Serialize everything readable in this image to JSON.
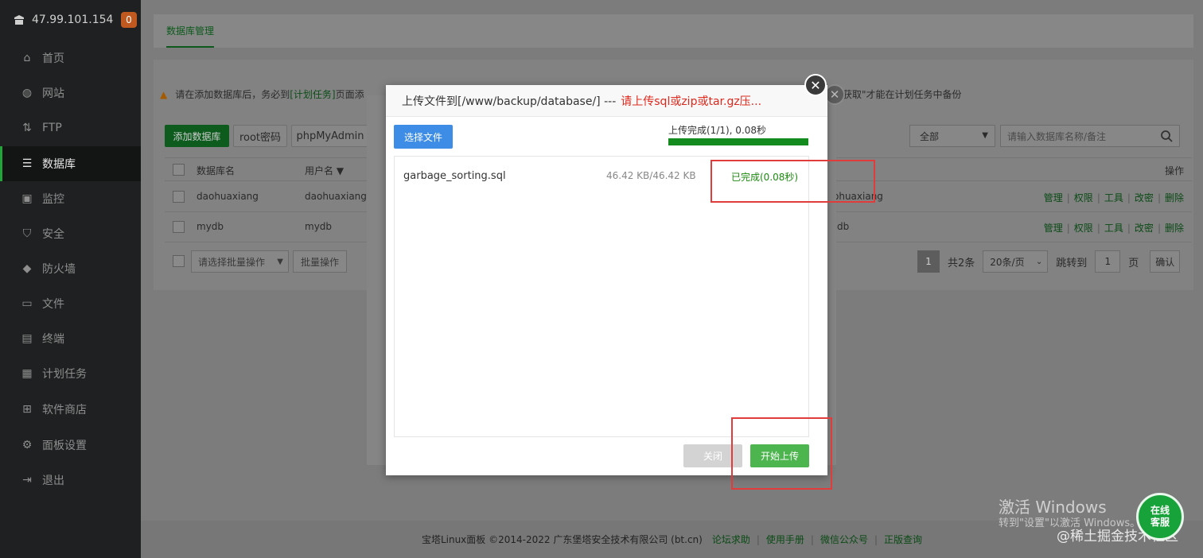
{
  "sidebar": {
    "host": "47.99.101.154",
    "badge": "0",
    "items": [
      {
        "label": "首页",
        "icon": "home-icon"
      },
      {
        "label": "网站",
        "icon": "globe-icon"
      },
      {
        "label": "FTP",
        "icon": "ftp-icon"
      },
      {
        "label": "数据库",
        "icon": "database-icon"
      },
      {
        "label": "监控",
        "icon": "monitor-icon"
      },
      {
        "label": "安全",
        "icon": "shield-icon"
      },
      {
        "label": "防火墙",
        "icon": "firewall-icon"
      },
      {
        "label": "文件",
        "icon": "folder-icon"
      },
      {
        "label": "终端",
        "icon": "terminal-icon"
      },
      {
        "label": "计划任务",
        "icon": "calendar-icon"
      },
      {
        "label": "软件商店",
        "icon": "apps-icon"
      },
      {
        "label": "面板设置",
        "icon": "settings-icon"
      },
      {
        "label": "退出",
        "icon": "logout-icon"
      }
    ],
    "active": "数据库"
  },
  "main": {
    "tab": "数据库管理",
    "warning_pre": "请在添加数据库后，务必到",
    "warning_link": "[计划任务]",
    "warning_post": "页面添",
    "warning_tail": "器获取\"才能在计划任务中备份",
    "toolbar": {
      "add": "添加数据库",
      "root": "root密码",
      "phpmyadmin": "phpMyAdmin",
      "filter": "全部",
      "search_placeholder": "请输入数据库名称/备注"
    },
    "table": {
      "headers": {
        "name": "数据库名",
        "user": "用户名",
        "ops": "操作"
      },
      "rows": [
        {
          "name": "daohuaxiang",
          "user": "daohuaxiang",
          "note": "ohuaxiang"
        },
        {
          "name": "mydb",
          "user": "mydb",
          "note": "db"
        }
      ],
      "ops": [
        "管理",
        "权限",
        "工具",
        "改密",
        "删除"
      ]
    },
    "batch": {
      "select": "请选择批量操作",
      "button": "批量操作"
    },
    "pager": {
      "page": "1",
      "total": "共2条",
      "per_page": "20条/页",
      "goto": "跳转到",
      "goto_value": "1",
      "page_unit": "页",
      "confirm": "确认"
    }
  },
  "footer": {
    "copyright": "宝塔Linux面板 ©2014-2022 广东堡塔安全技术有限公司 (bt.cn)",
    "links": [
      "论坛求助",
      "使用手册",
      "微信公众号",
      "正版查询"
    ]
  },
  "modal": {
    "title": "上传文件到[/www/backup/database/] ---",
    "title_warning": "请上传sql或zip或tar.gz压...",
    "choose_button": "选择文件",
    "progress_label": "上传完成(1/1), 0.08秒",
    "progress": 1.0,
    "file": {
      "name": "garbage_sorting.sql",
      "size": "46.42 KB/46.42 KB",
      "status": "已完成(0.08秒)"
    },
    "close_button": "关闭",
    "start_button": "开始上传"
  },
  "overlay": {
    "watermark_title": "激活 Windows",
    "watermark_sub": "转到\"设置\"以激活 Windows。",
    "credit": "@稀土掘金技术社区",
    "chat_line1": "在线",
    "chat_line2": "客服"
  },
  "colors": {
    "accent_green": "#20a53a",
    "danger_red": "#e0281c",
    "choose_blue": "#3d8ce6"
  }
}
